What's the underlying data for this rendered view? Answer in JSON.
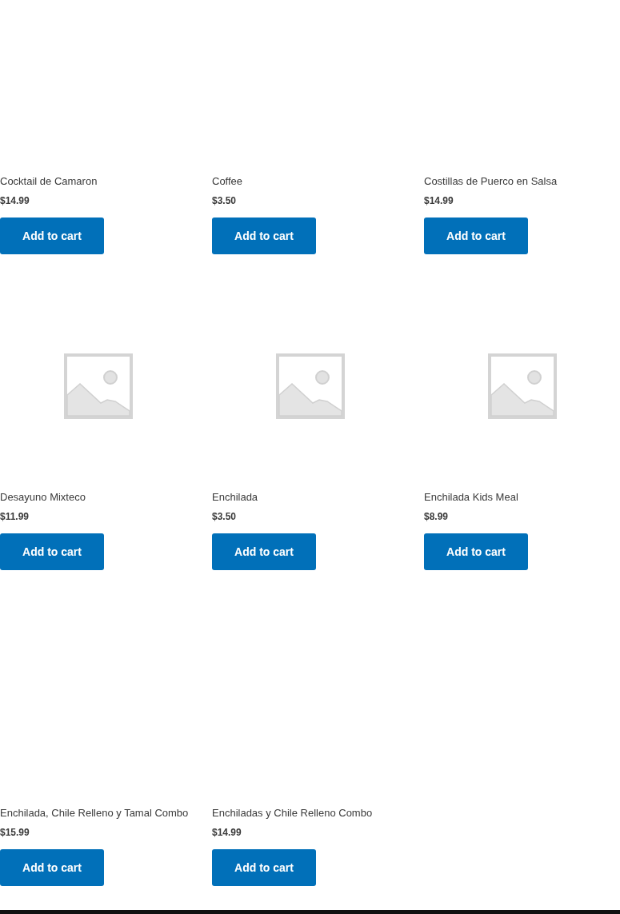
{
  "products": [
    {
      "name": "Cocktail de Camaron",
      "price": "$14.99",
      "button": "Add to cart",
      "image_shown": false
    },
    {
      "name": "Coffee",
      "price": "$3.50",
      "button": "Add to cart",
      "image_shown": false
    },
    {
      "name": "Costillas de Puerco en Salsa",
      "price": "$14.99",
      "button": "Add to cart",
      "image_shown": false
    },
    {
      "name": "Desayuno Mixteco",
      "price": "$11.99",
      "button": "Add to cart",
      "image_shown": true
    },
    {
      "name": "Enchilada",
      "price": "$3.50",
      "button": "Add to cart",
      "image_shown": true
    },
    {
      "name": "Enchilada Kids Meal",
      "price": "$8.99",
      "button": "Add to cart",
      "image_shown": true
    },
    {
      "name": "Enchilada, Chile Relleno y Tamal Combo",
      "price": "$15.99",
      "button": "Add to cart",
      "image_shown": false
    },
    {
      "name": "Enchiladas y Chile Relleno Combo",
      "price": "$14.99",
      "button": "Add to cart",
      "image_shown": false
    }
  ]
}
